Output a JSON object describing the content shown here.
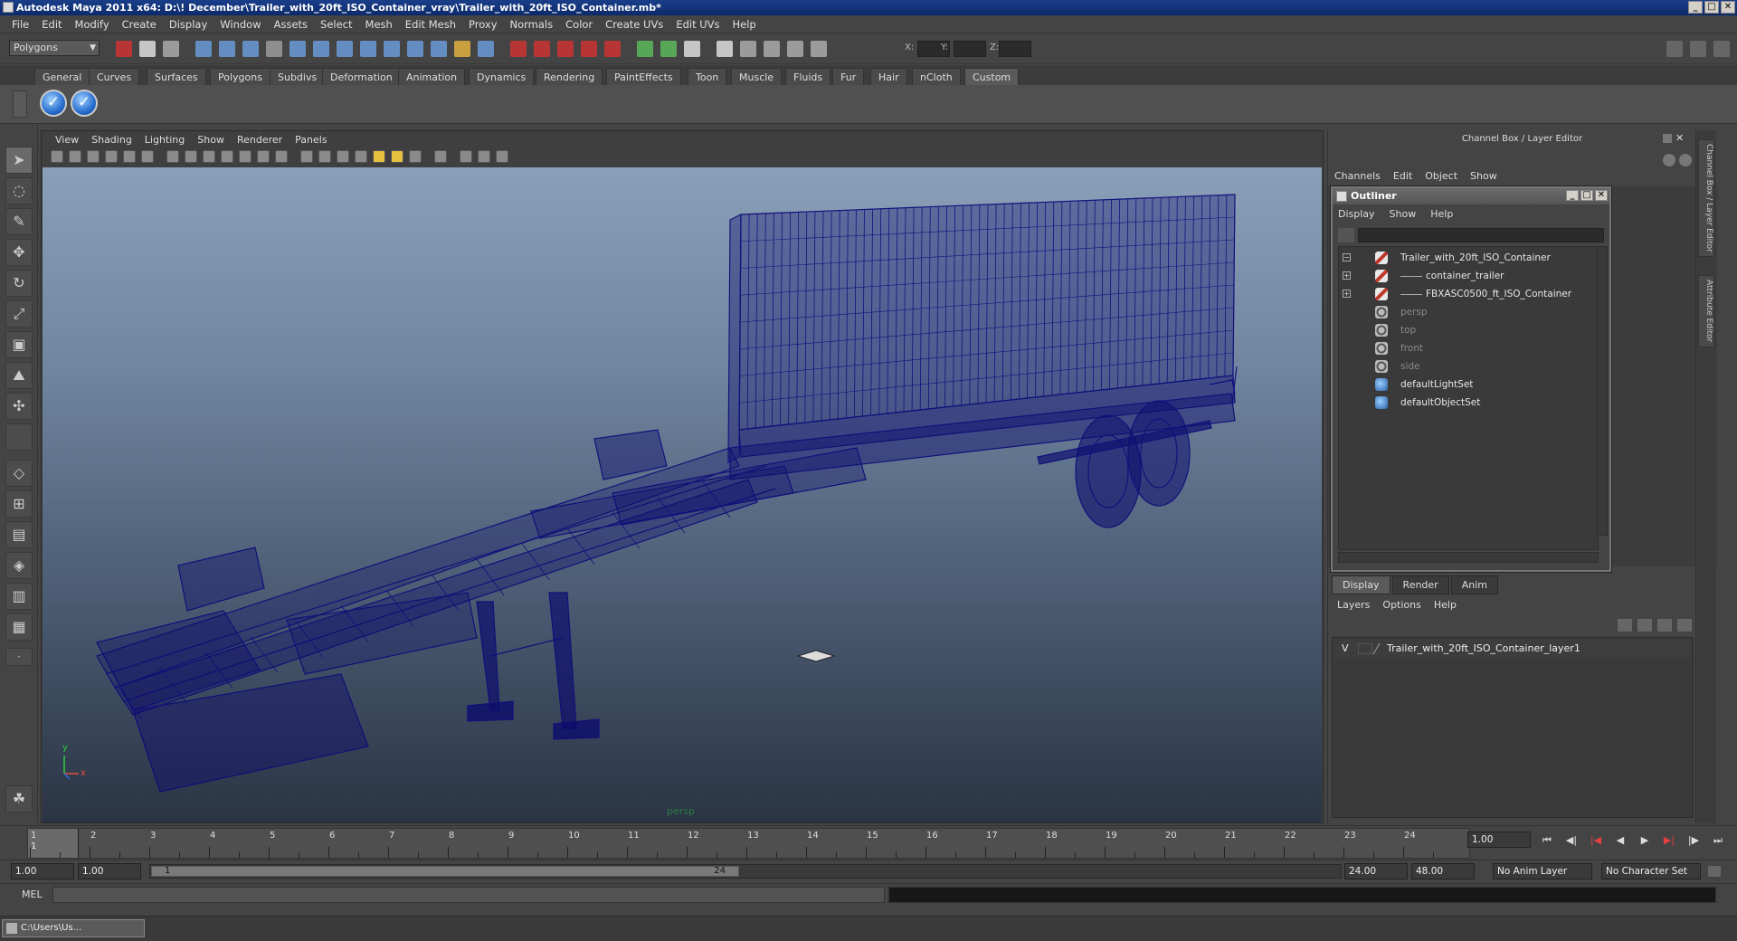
{
  "window": {
    "title": "Autodesk Maya 2011 x64: D:\\! December\\Trailer_with_20ft_ISO_Container_vray\\Trailer_with_20ft_ISO_Container.mb*",
    "min": "_",
    "max": "□",
    "close": "✕"
  },
  "menu": [
    "File",
    "Edit",
    "Modify",
    "Create",
    "Display",
    "Window",
    "Assets",
    "Select",
    "Mesh",
    "Edit Mesh",
    "Proxy",
    "Normals",
    "Color",
    "Create UVs",
    "Edit UVs",
    "Help"
  ],
  "statusline": {
    "mode": "Polygons",
    "x_label": "X:",
    "y_label": "Y:",
    "z_label": "Z:"
  },
  "shelf": {
    "tabs": [
      "General",
      "Curves",
      "Surfaces",
      "Polygons",
      "Subdivs",
      "Deformation",
      "Animation",
      "Dynamics",
      "Rendering",
      "PaintEffects",
      "Toon",
      "Muscle",
      "Fluids",
      "Fur",
      "Hair",
      "nCloth",
      "Custom"
    ],
    "active_tab": "Custom",
    "buttons": [
      "✓",
      "✓"
    ]
  },
  "viewport": {
    "menu": [
      "View",
      "Shading",
      "Lighting",
      "Show",
      "Renderer",
      "Panels"
    ],
    "camera_label": "persp",
    "axis_y": "y",
    "axis_x": "x"
  },
  "channel_box": {
    "title": "Channel Box / Layer Editor",
    "menu": [
      "Channels",
      "Edit",
      "Object",
      "Show"
    ],
    "side_tabs": [
      "Channel Box / Layer Editor",
      "Attribute Editor"
    ]
  },
  "outliner": {
    "title": "Outliner",
    "menu": [
      "Display",
      "Show",
      "Help"
    ],
    "items": [
      {
        "label": "Trailer_with_20ft_ISO_Container",
        "icon": "mesh-icon",
        "expander": "−",
        "dim": false
      },
      {
        "label": "container_trailer",
        "icon": "mesh-icon",
        "expander": "+",
        "dim": false
      },
      {
        "label": "FBXASC0500_ft_ISO_Container",
        "icon": "mesh-icon",
        "expander": "+",
        "dim": false
      },
      {
        "label": "persp",
        "icon": "camera-icon",
        "expander": "",
        "dim": true
      },
      {
        "label": "top",
        "icon": "camera-icon",
        "expander": "",
        "dim": true
      },
      {
        "label": "front",
        "icon": "camera-icon",
        "expander": "",
        "dim": true
      },
      {
        "label": "side",
        "icon": "camera-icon",
        "expander": "",
        "dim": true
      },
      {
        "label": "defaultLightSet",
        "icon": "set-icon",
        "expander": "",
        "dim": false
      },
      {
        "label": "defaultObjectSet",
        "icon": "set-icon",
        "expander": "",
        "dim": false
      }
    ]
  },
  "layer_editor": {
    "tabs": [
      "Display",
      "Render",
      "Anim"
    ],
    "active_tab": "Display",
    "menu": [
      "Layers",
      "Options",
      "Help"
    ],
    "layers": [
      {
        "visible": "V",
        "name": "Trailer_with_20ft_ISO_Container_layer1"
      }
    ]
  },
  "time_slider": {
    "ticks": [
      "1",
      "2",
      "3",
      "4",
      "5",
      "6",
      "7",
      "8",
      "9",
      "10",
      "11",
      "12",
      "13",
      "14",
      "15",
      "16",
      "17",
      "18",
      "19",
      "20",
      "21",
      "22",
      "23",
      "24"
    ],
    "current_frame": "1",
    "current_time": "1.00"
  },
  "range_slider": {
    "start_time": "1.00",
    "playback_start": "1.00",
    "range_start": "1",
    "range_end": "24",
    "playback_end": "24.00",
    "end_time": "48.00",
    "anim_layer": "No Anim Layer",
    "character_set": "No Character Set"
  },
  "command_line": {
    "label": "MEL"
  },
  "taskbar": {
    "item": "C:\\Users\\Us..."
  },
  "colors": {
    "wireframe": "#0d0d7a",
    "viewport_top": "#8a9fb8",
    "viewport_bottom": "#2a3444",
    "title_bar": "#1a3e8a"
  }
}
